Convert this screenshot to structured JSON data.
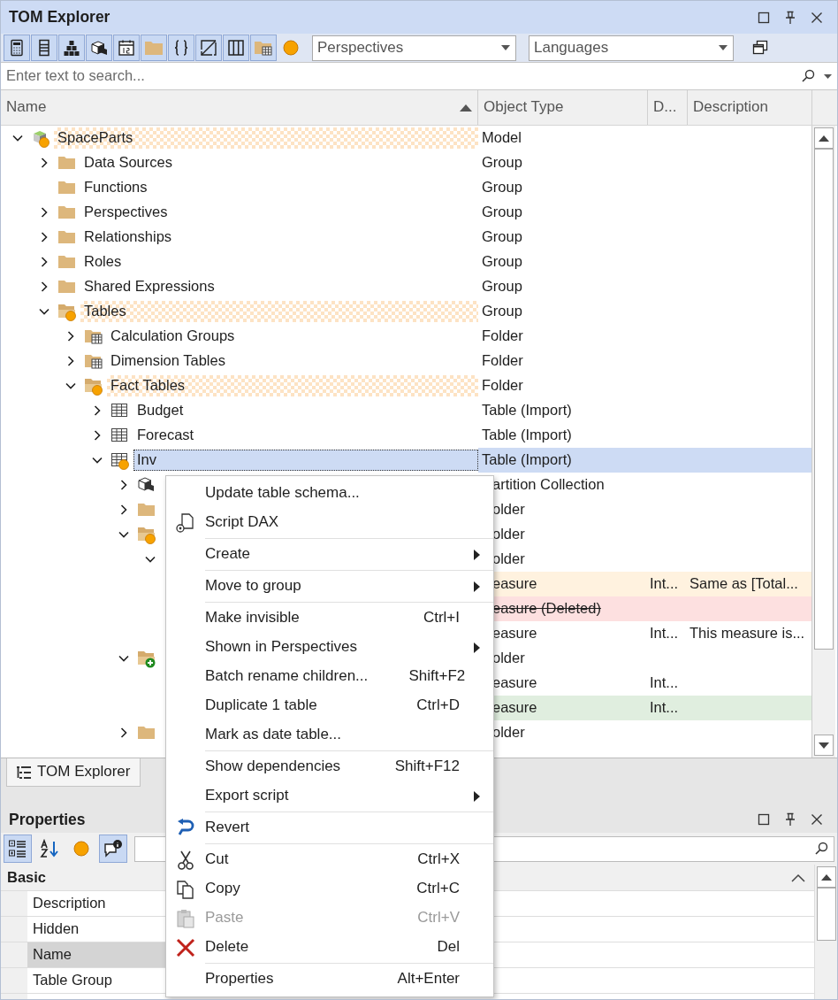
{
  "window": {
    "title": "TOM Explorer"
  },
  "toolbar": {
    "buttons": [
      {
        "pressed": true
      },
      {
        "pressed": true
      },
      {
        "pressed": true
      },
      {
        "pressed": true
      },
      {
        "pressed": true
      },
      {
        "pressed": true
      },
      {
        "pressed": true
      },
      {
        "pressed": true
      },
      {
        "pressed": true
      },
      {
        "pressed": true
      },
      {
        "pressed": false
      }
    ],
    "perspectives": {
      "value": "Perspectives"
    },
    "languages": {
      "value": "Languages"
    }
  },
  "search": {
    "placeholder": "Enter text to search..."
  },
  "columns": [
    {
      "label": "Name",
      "sorted": true
    },
    {
      "label": "Object Type",
      "sorted": false
    },
    {
      "label": "D...",
      "sorted": false
    },
    {
      "label": "Description",
      "sorted": false
    }
  ],
  "tree": [
    {
      "name": "SpaceParts",
      "type": "Model",
      "kind": "model",
      "changed": true,
      "modified": true,
      "selected": false,
      "expanded": true,
      "children": [
        {
          "name": "Data Sources",
          "type": "Group",
          "kind": "folder",
          "selected": false,
          "expanded": false
        },
        {
          "name": "Functions",
          "type": "Group",
          "kind": "folder",
          "selected": false
        },
        {
          "name": "Perspectives",
          "type": "Group",
          "kind": "folder",
          "selected": false,
          "expanded": false
        },
        {
          "name": "Relationships",
          "type": "Group",
          "kind": "folder",
          "selected": false,
          "expanded": false
        },
        {
          "name": "Roles",
          "type": "Group",
          "kind": "folder",
          "selected": false,
          "expanded": false
        },
        {
          "name": "Shared Expressions",
          "type": "Group",
          "kind": "folder",
          "selected": false,
          "expanded": false
        },
        {
          "name": "Tables",
          "type": "Group",
          "kind": "open-folder",
          "changed": true,
          "modified": true,
          "selected": false,
          "expanded": true,
          "children": [
            {
              "name": "Calculation Groups",
              "type": "Folder",
              "kind": "table-folder",
              "selected": false,
              "expanded": false
            },
            {
              "name": "Dimension Tables",
              "type": "Folder",
              "kind": "table-folder",
              "selected": false,
              "expanded": false
            },
            {
              "name": "Fact Tables",
              "type": "Folder",
              "kind": "open-folder",
              "changed": true,
              "modified": true,
              "selected": false,
              "expanded": true,
              "children": [
                {
                  "name": "Budget",
                  "type": "Table (Import)",
                  "kind": "table",
                  "selected": false,
                  "expanded": false
                },
                {
                  "name": "Forecast",
                  "type": "Table (Import)",
                  "kind": "table",
                  "selected": false,
                  "expanded": false
                },
                {
                  "name": "Inv",
                  "type": "Table (Import)",
                  "kind": "table",
                  "changed": true,
                  "selected": true,
                  "expanded": true,
                  "children": [
                    {
                      "type": "artition Collection",
                      "kind": "partition",
                      "selected": false,
                      "expanded": false
                    },
                    {
                      "type": "older",
                      "kind": "folder",
                      "selected": false,
                      "expanded": false
                    },
                    {
                      "type": "older",
                      "kind": "open-folder",
                      "changed": true,
                      "selected": false,
                      "expanded": true,
                      "children": [
                        {
                          "type": "older",
                          "selected": false,
                          "expanded": true,
                          "children": [
                            {
                              "type": "easure",
                              "data_type": "Int...",
                              "description": "Same as [Total...",
                              "color": "#fff2df",
                              "selected": false
                            },
                            {
                              "type": "easure (Deleted)",
                              "deleted": true,
                              "color": "#fde0e0",
                              "selected": false
                            },
                            {
                              "type": "easure",
                              "data_type": "Int...",
                              "description": "This measure is...",
                              "selected": false
                            }
                          ]
                        }
                      ]
                    },
                    {
                      "type": "older",
                      "kind": "open-folder",
                      "new": true,
                      "selected": false,
                      "expanded": true,
                      "children": [
                        {
                          "type": "easure",
                          "data_type": "Int...",
                          "selected": false
                        },
                        {
                          "type": "easure",
                          "data_type": "Int...",
                          "color": "#e0eedf",
                          "selected": false
                        }
                      ]
                    },
                    {
                      "type": "older",
                      "kind": "folder",
                      "selected": false,
                      "expanded": false
                    }
                  ]
                }
              ]
            }
          ]
        }
      ]
    }
  ],
  "tabs": [
    {
      "label": "TOM Explorer",
      "selected": true
    }
  ],
  "properties": {
    "title": "Properties",
    "toolbar": [
      {
        "pressed": true
      },
      {
        "pressed": false
      },
      {
        "pressed": false
      },
      {
        "pressed": true
      }
    ],
    "category": {
      "label": "Basic",
      "expanded": true
    },
    "rows": [
      {
        "name": "Description",
        "selected": false
      },
      {
        "name": "Hidden",
        "selected": false
      },
      {
        "name": "Name",
        "selected": true
      },
      {
        "name": "Table Group",
        "selected": false
      }
    ]
  },
  "context_menu": {
    "items": [
      {
        "kind": "item",
        "label": "Update table schema..."
      },
      {
        "kind": "item",
        "label": "Script DAX"
      },
      {
        "kind": "separator"
      },
      {
        "kind": "item",
        "label": "Create",
        "submenu": true
      },
      {
        "kind": "separator"
      },
      {
        "kind": "item",
        "label": "Move to group",
        "submenu": true
      },
      {
        "kind": "separator"
      },
      {
        "kind": "item",
        "label": "Make invisible",
        "shortcut": "Ctrl+I"
      },
      {
        "kind": "item",
        "label": "Shown in Perspectives",
        "submenu": true
      },
      {
        "kind": "item",
        "label": "Batch rename children...",
        "shortcut": "Shift+F2"
      },
      {
        "kind": "item",
        "label": "Duplicate 1 table",
        "shortcut": "Ctrl+D"
      },
      {
        "kind": "item",
        "label": "Mark as date table..."
      },
      {
        "kind": "separator"
      },
      {
        "kind": "item",
        "label": "Show dependencies",
        "shortcut": "Shift+F12"
      },
      {
        "kind": "item",
        "label": "Export script",
        "submenu": true
      },
      {
        "kind": "separator"
      },
      {
        "kind": "item",
        "label": "Revert"
      },
      {
        "kind": "separator"
      },
      {
        "kind": "item",
        "label": "Cut",
        "shortcut": "Ctrl+X"
      },
      {
        "kind": "item",
        "label": "Copy",
        "shortcut": "Ctrl+C"
      },
      {
        "kind": "item",
        "label": "Paste",
        "shortcut": "Ctrl+V",
        "disabled": true
      },
      {
        "kind": "item",
        "label": "Delete",
        "shortcut": "Del"
      },
      {
        "kind": "separator"
      },
      {
        "kind": "item",
        "label": "Properties",
        "shortcut": "Alt+Enter"
      }
    ]
  }
}
